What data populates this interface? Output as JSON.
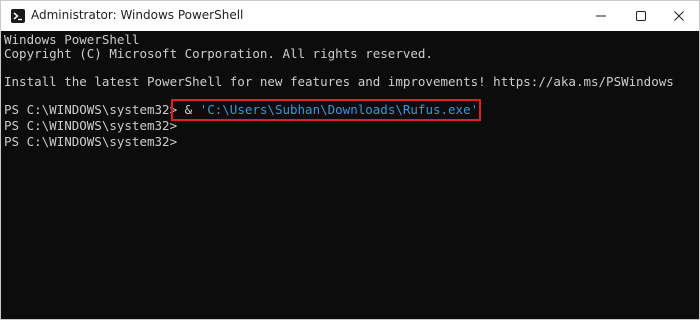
{
  "window": {
    "title": "Administrator: Windows PowerShell",
    "icon": "powershell-icon",
    "controls": [
      "minimize-icon",
      "maximize-icon",
      "close-icon"
    ]
  },
  "console": {
    "lines": [
      "Windows PowerShell",
      "Copyright (C) Microsoft Corporation. All rights reserved.",
      "Install the latest PowerShell for new features and improvements! https://aka.ms/PSWindows"
    ],
    "prompt": "PS C:\\WINDOWS\\system32>",
    "command_operator": "&",
    "command_path": "'C:\\Users\\Subhan\\Downloads\\Rufus.exe'"
  },
  "colors": {
    "background": "#0c0c0c",
    "text": "#cccccc",
    "string": "#3a96dd",
    "highlight_border": "#e02020"
  }
}
